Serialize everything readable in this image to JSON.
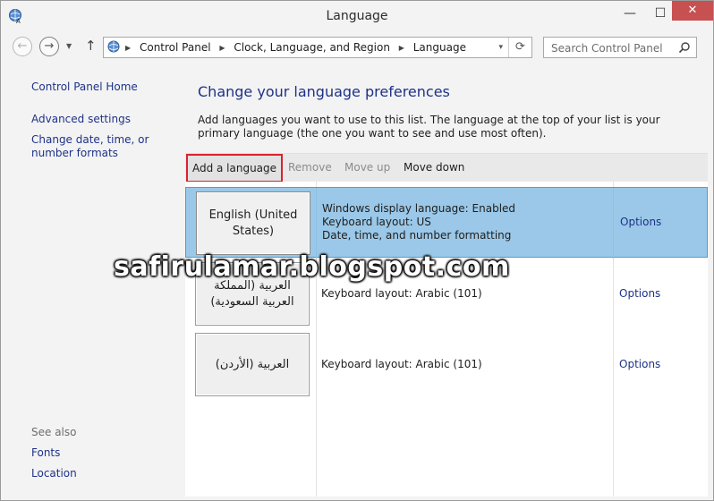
{
  "window": {
    "title": "Language",
    "controls": {
      "minimize": "—",
      "maximize": "☐",
      "close": "✕"
    }
  },
  "navigation": {
    "back_icon": "back-arrow-icon",
    "forward_icon": "forward-arrow-icon",
    "breadcrumbs": [
      "Control Panel",
      "Clock, Language, and Region",
      "Language"
    ],
    "search_placeholder": "Search Control Panel"
  },
  "sidebar": {
    "home": "Control Panel Home",
    "links": [
      "Advanced settings",
      "Change date, time, or number formats"
    ],
    "see_also_title": "See also",
    "see_also": [
      "Fonts",
      "Location"
    ]
  },
  "main": {
    "heading": "Change your language preferences",
    "description": "Add languages you want to use to this list. The language at the top of your list is your primary language (the one you want to see and use most often).",
    "toolbar": {
      "add": "Add a language",
      "remove": "Remove",
      "move_up": "Move up",
      "move_down": "Move down"
    },
    "languages": [
      {
        "name": "English (United States)",
        "details": [
          "Windows display language: Enabled",
          "Keyboard layout: US",
          "Date, time, and number formatting"
        ],
        "options": "Options",
        "selected": true
      },
      {
        "name": "العربية (المملكة العربية السعودية)",
        "details": [
          "Keyboard layout: Arabic (101)"
        ],
        "options": "Options",
        "selected": false
      },
      {
        "name": "العربية (الأردن)",
        "details": [
          "Keyboard layout: Arabic (101)"
        ],
        "options": "Options",
        "selected": false
      }
    ]
  },
  "watermark": "safirulamar.blogspot.com",
  "colors": {
    "link": "#1e3287",
    "selected_row": "#9bc8e8",
    "highlight_border": "#d9232e",
    "close_button": "#c75050"
  }
}
